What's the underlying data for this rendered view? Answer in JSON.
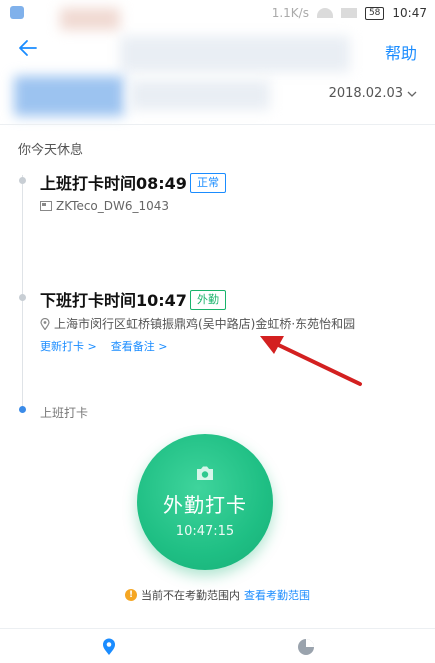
{
  "status_bar": {
    "speed": "1.1K/s",
    "battery": "58",
    "time": "10:47"
  },
  "header": {
    "help_label": "帮助",
    "date": "2018.02.03"
  },
  "rest_note": "你今天休息",
  "records": [
    {
      "title": "上班打卡时间08:49",
      "tag": "正常",
      "device": "ZKTeco_DW6_1043"
    },
    {
      "title": "下班打卡时间10:47",
      "tag": "外勤",
      "location": "上海市闵行区虹桥镇振鼎鸡(吴中路店)金虹桥·东苑怡和园",
      "update_link": "更新打卡 >",
      "remark_link": "查看备注 >"
    }
  ],
  "next_label": "上班打卡",
  "punch_button": {
    "label": "外勤打卡",
    "time": "10:47:15"
  },
  "range_warning": {
    "text": "当前不在考勤范围内",
    "link": "查看考勤范围"
  },
  "colors": {
    "accent": "#1a8cff",
    "green": "#1fbf84",
    "arrow": "#d32020"
  },
  "tabs": [
    {
      "icon": "location-pin-icon"
    },
    {
      "icon": "pie-chart-icon"
    }
  ]
}
